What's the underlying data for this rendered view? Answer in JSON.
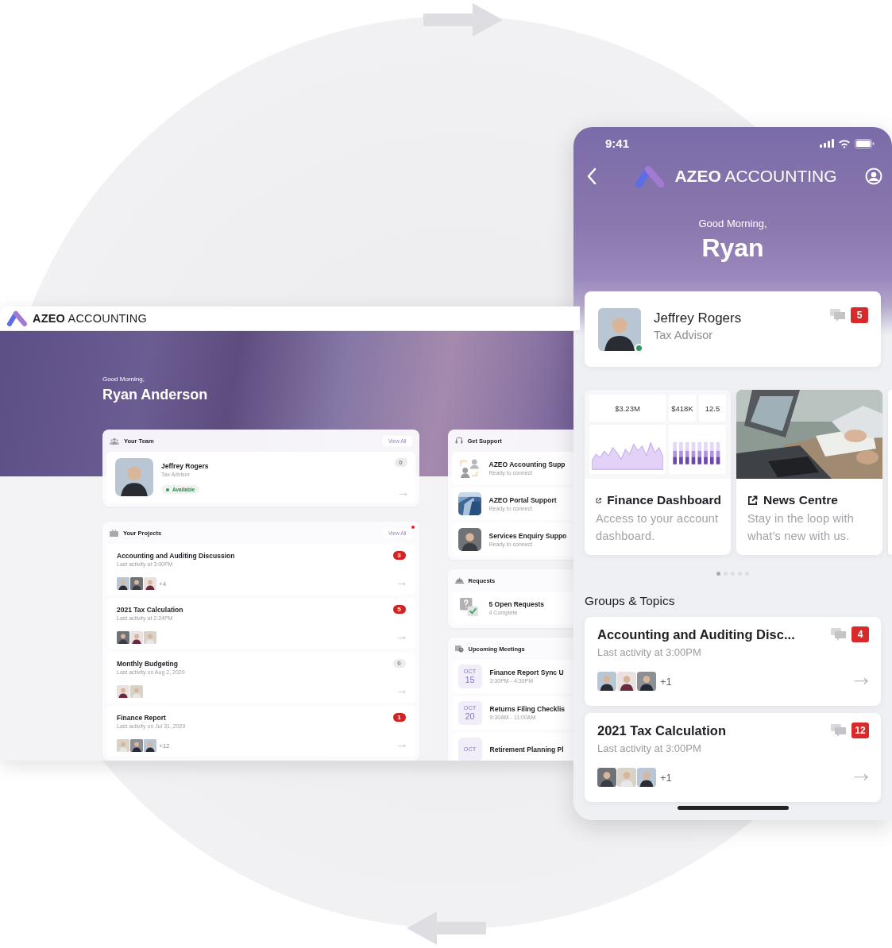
{
  "desktop": {
    "brand": {
      "bold": "AZEO",
      "light": "ACCOUNTING"
    },
    "greeting": "Good Morning,",
    "user_name": "Ryan Anderson",
    "team": {
      "title": "Your Team",
      "view_all": "View All",
      "member": {
        "name": "Jeffrey Rogers",
        "role": "Tax Advisor",
        "status": "Available",
        "count": "0",
        "unread": false
      }
    },
    "projects": {
      "title": "Your Projects",
      "view_all": "View All",
      "notification_dot": true,
      "items": [
        {
          "title": "Accounting and Auditing Discussion",
          "activity": "Last activity at 3:00PM",
          "count": "3",
          "unread": true,
          "extra": "+4"
        },
        {
          "title": "2021 Tax Calculation",
          "activity": "Last activity at 2:24PM",
          "count": "5",
          "unread": true
        },
        {
          "title": "Monthly Budgeting",
          "activity": "Last activity on Aug 2, 2020",
          "count": "0",
          "unread": false
        },
        {
          "title": "Finance Report",
          "activity": "Last activity on Jul 31, 2020",
          "count": "1",
          "unread": true,
          "extra": "+12"
        }
      ]
    },
    "support": {
      "title": "Get Support",
      "items": [
        {
          "kind": "icon",
          "name": "AZEO Accounting Supp",
          "status": "Ready to connect"
        },
        {
          "kind": "picture",
          "name": "AZEO Portal Support",
          "status": "Ready to connect"
        },
        {
          "kind": "avatar",
          "name": "Services Enquiry Suppo",
          "status": "Ready to connect"
        }
      ]
    },
    "requests": {
      "title": "Requests",
      "summary": "5 Open Requests",
      "detail": "4 Complete"
    },
    "meetings": {
      "title": "Upcoming Meetings",
      "items": [
        {
          "month": "OCT",
          "day": "15",
          "title": "Finance Report Sync U",
          "time": "3:30PM - 4:30PM"
        },
        {
          "month": "OCT",
          "day": "20",
          "title": "Returns Filing Checklis",
          "time": "9:30AM - 11:00AM"
        },
        {
          "month": "OCT",
          "title": "Retirement Planning Pl"
        }
      ]
    }
  },
  "mobile": {
    "time": "9:41",
    "brand": {
      "bold": "AZEO",
      "light": "ACCOUNTING"
    },
    "greeting": "Good Morning,",
    "user_name": "Ryan",
    "advisor": {
      "name": "Jeffrey Rogers",
      "role": "Tax Advisor",
      "online": true,
      "count": "5"
    },
    "tiles": [
      {
        "kind": "dashboard",
        "title": "Finance Dashboard",
        "description": "Access to your account dashboard.",
        "stats": [
          "$3.23M",
          "$418K",
          "12.5"
        ]
      },
      {
        "kind": "picture",
        "title": "News Centre",
        "description": "Stay in the loop with what’s new with us."
      }
    ],
    "pager": [
      {
        "selected": true
      },
      {
        "selected": false
      },
      {
        "selected": false
      },
      {
        "selected": false
      },
      {
        "selected": false
      }
    ],
    "section_title": "Groups & Topics",
    "groups": [
      {
        "title": "Accounting and Auditing Disc...",
        "activity": "Last activity at 3:00PM",
        "count": "4",
        "extra": "+1"
      },
      {
        "title": "2021 Tax Calculation",
        "activity": "Last activity at 3:00PM",
        "count": "12",
        "extra": "+1"
      }
    ]
  }
}
